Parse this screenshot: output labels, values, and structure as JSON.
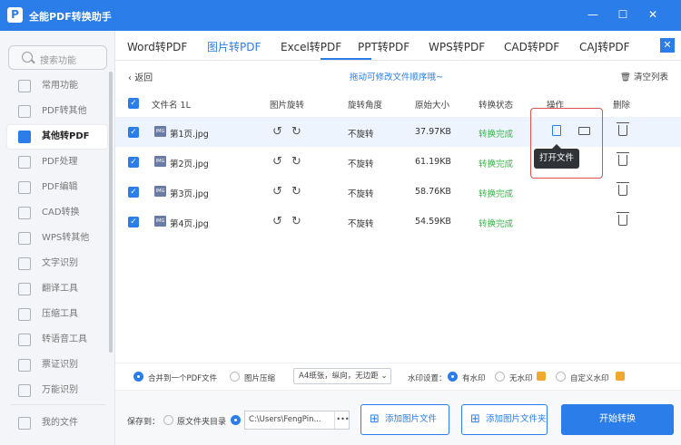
{
  "app": {
    "title": "全能PDF转换助手",
    "logo": "P"
  },
  "window": {
    "minimize": "—",
    "maximize": "☐",
    "close": "✕"
  },
  "search": {
    "placeholder": "搜索功能"
  },
  "sidebar": {
    "items": [
      {
        "label": "常用功能"
      },
      {
        "label": "PDF转其他"
      },
      {
        "label": "其他转PDF"
      },
      {
        "label": "PDF处理"
      },
      {
        "label": "PDF编辑"
      },
      {
        "label": "CAD转换"
      },
      {
        "label": "WPS转其他"
      },
      {
        "label": "文字识别"
      },
      {
        "label": "翻译工具"
      },
      {
        "label": "压缩工具"
      },
      {
        "label": "转语音工具"
      },
      {
        "label": "票证识别"
      },
      {
        "label": "万能识别"
      },
      {
        "label": "我的文件"
      }
    ],
    "active_index": 2
  },
  "tabs": [
    {
      "label": "Word转PDF"
    },
    {
      "label": "图片转PDF"
    },
    {
      "label": "Excel转PDF"
    },
    {
      "label": "PPT转PDF"
    },
    {
      "label": "WPS转PDF"
    },
    {
      "label": "CAD转PDF"
    },
    {
      "label": "CAJ转PDF"
    }
  ],
  "active_tab": 1,
  "toolbar": {
    "back": "返回",
    "hint": "拖动可修改文件顺序哦~",
    "clear": "清空列表"
  },
  "table": {
    "headers": {
      "name": "文件名",
      "sort": "1L",
      "rotate": "图片旋转",
      "angle": "旋转角度",
      "size": "原始大小",
      "status": "转换状态",
      "ops": "操作",
      "delete": "删除"
    },
    "rows": [
      {
        "name": "第1页.jpg",
        "angle": "不旋转",
        "size": "37.97KB",
        "status": "转换完成"
      },
      {
        "name": "第2页.jpg",
        "angle": "不旋转",
        "size": "61.19KB",
        "status": "转换完成"
      },
      {
        "name": "第3页.jpg",
        "angle": "不旋转",
        "size": "58.76KB",
        "status": "转换完成"
      },
      {
        "name": "第4页.jpg",
        "angle": "不旋转",
        "size": "54.59KB",
        "status": "转换完成"
      }
    ],
    "file_icon_text": "IMG",
    "rotate_left": "↺",
    "rotate_right": "↻"
  },
  "tooltip": {
    "open_file": "打开文件"
  },
  "options": {
    "merge": "合并到一个PDF文件",
    "compress": "图片压缩",
    "page_setting": "A4纸张，纵向，无边距",
    "watermark_label": "水印设置：",
    "with_watermark": "有水印",
    "no_watermark": "无水印",
    "custom_watermark": "自定义水印"
  },
  "footer": {
    "save_to": "保存到：",
    "source_dir": "原文件夹目录",
    "path": "C:\\Users\\FengPin...",
    "path_more": "•••",
    "add_images": "添加图片文件",
    "add_folder": "添加图片文件夹",
    "start": "开始转换"
  },
  "colors": {
    "accent": "#2b7de9",
    "success": "#3bb54a",
    "highlight": "#d9534f"
  }
}
